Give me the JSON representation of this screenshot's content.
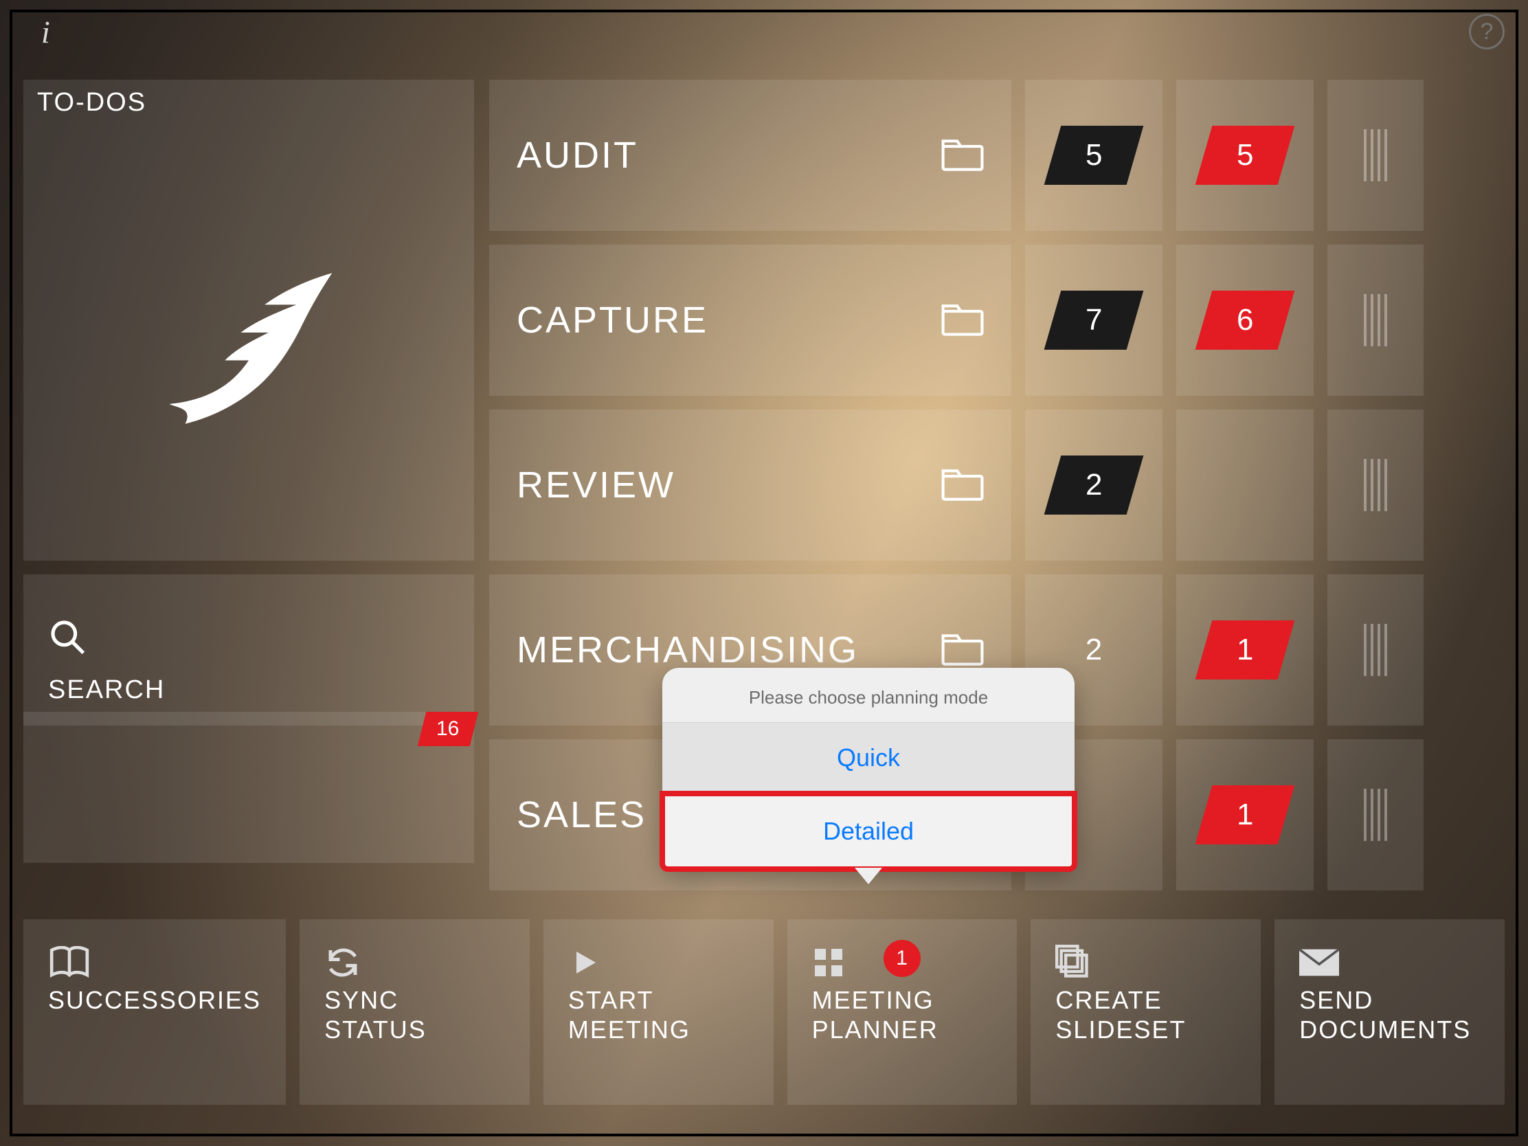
{
  "header": {
    "todos_label": "TO-DOS"
  },
  "search": {
    "label": "SEARCH"
  },
  "left_panel": {
    "badge_count": "16"
  },
  "categories": [
    {
      "label": "AUDIT",
      "count1": "5",
      "count1_style": "dark",
      "count2": "5"
    },
    {
      "label": "CAPTURE",
      "count1": "7",
      "count1_style": "dark",
      "count2": "6"
    },
    {
      "label": "REVIEW",
      "count1": "2",
      "count1_style": "dark",
      "count2": ""
    },
    {
      "label": "MERCHANDISING",
      "count1": "2",
      "count1_style": "plain",
      "count2": "1"
    },
    {
      "label": "SALES",
      "count1": "",
      "count1_style": "",
      "count2": "1"
    }
  ],
  "popover": {
    "title": "Please choose planning mode",
    "option_quick": "Quick",
    "option_detailed": "Detailed"
  },
  "bottom": [
    {
      "label": "SUCCESSORIES",
      "icon": "book"
    },
    {
      "label": "SYNC STATUS",
      "icon": "sync"
    },
    {
      "label": "START\nMEETING",
      "icon": "play"
    },
    {
      "label": "MEETING\nPLANNER",
      "icon": "grid",
      "badge": "1"
    },
    {
      "label": "CREATE\nSLIDESET",
      "icon": "stack"
    },
    {
      "label": "SEND\nDOCUMENTS",
      "icon": "mail"
    }
  ]
}
